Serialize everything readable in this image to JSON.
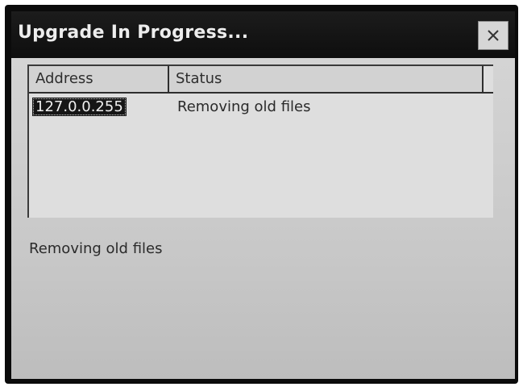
{
  "window": {
    "title": "Upgrade In Progress...",
    "close_icon": "close-icon"
  },
  "list": {
    "columns": [
      "Address",
      "Status"
    ],
    "rows": [
      {
        "address": "127.0.0.255",
        "status": "Removing old files",
        "selected": true
      }
    ]
  },
  "status_message": "Removing old files",
  "colors": {
    "titlebar": "#111111",
    "client": "#c9c9c9",
    "selection": "#161616"
  }
}
